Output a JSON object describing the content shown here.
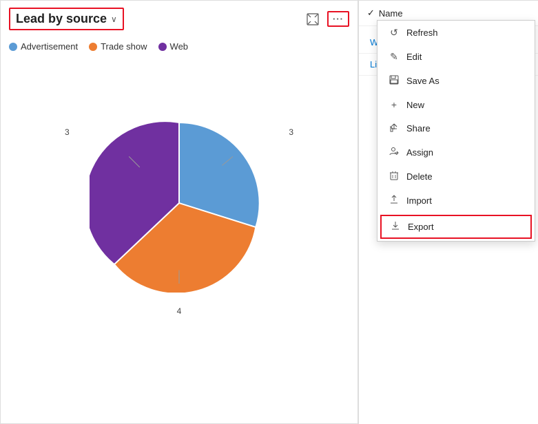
{
  "chart": {
    "title": "Lead by source",
    "chevron": "∨",
    "legend": [
      {
        "label": "Advertisement",
        "color": "#5b9bd5"
      },
      {
        "label": "Trade show",
        "color": "#ed7d31"
      },
      {
        "label": "Web",
        "color": "#7030a0"
      }
    ],
    "slices": [
      {
        "label": "3",
        "color": "#5b9bd5",
        "startAngle": -90,
        "endAngle": 18
      },
      {
        "label": "4",
        "color": "#ed7d31",
        "startAngle": 18,
        "endAngle": 162
      },
      {
        "label": "3",
        "color": "#7030a0",
        "startAngle": 162,
        "endAngle": 270
      }
    ]
  },
  "toolbar": {
    "expand_icon": "⊡",
    "more_icon": "···"
  },
  "right_panel": {
    "column_name": "Name",
    "check_mark": "✓",
    "names": [
      "Wanda Graves",
      "Lisa Byrd"
    ]
  },
  "menu": {
    "items": [
      {
        "icon": "↺",
        "label": "Refresh",
        "highlighted": false
      },
      {
        "icon": "✎",
        "label": "Edit",
        "highlighted": false
      },
      {
        "icon": "⊟",
        "label": "Save As",
        "highlighted": false
      },
      {
        "icon": "+",
        "label": "New",
        "highlighted": false
      },
      {
        "icon": "↗",
        "label": "Share",
        "highlighted": false
      },
      {
        "icon": "👤",
        "label": "Assign",
        "highlighted": false
      },
      {
        "icon": "🗑",
        "label": "Delete",
        "highlighted": false
      },
      {
        "icon": "↑",
        "label": "Import",
        "highlighted": false
      },
      {
        "icon": "↓",
        "label": "Export",
        "highlighted": true
      }
    ]
  }
}
